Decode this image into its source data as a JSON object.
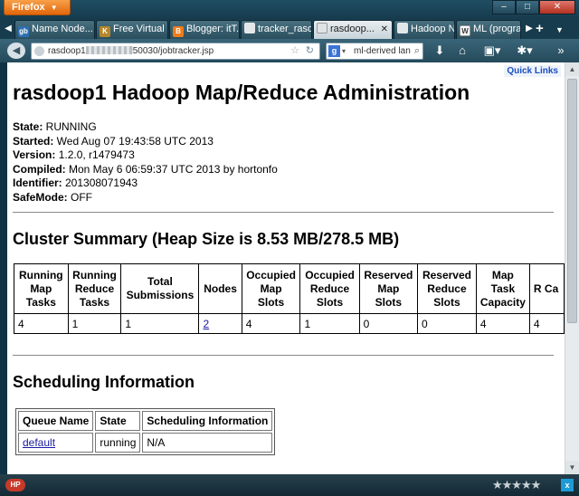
{
  "browser": {
    "menu_button": "Firefox",
    "window_buttons": {
      "minimize": "–",
      "maximize": "□",
      "close": "✕"
    },
    "tabs": [
      {
        "label": "Name Node...",
        "favicon": "gb",
        "favicon_color": "#2d6fb0",
        "active": false
      },
      {
        "label": "Free Virtual ...",
        "favicon": "K",
        "favicon_color": "#b5862a",
        "active": false
      },
      {
        "label": "Blogger: itT...",
        "favicon": "B",
        "favicon_color": "#f07b1a",
        "active": false
      },
      {
        "label": "tracker_rasd...",
        "favicon": "",
        "favicon_color": "#e4e7ea",
        "active": false
      },
      {
        "label": "rasdoop...",
        "favicon": "",
        "favicon_color": "#dfe3e6",
        "active": true
      },
      {
        "label": "Hadoop Na...",
        "favicon": "",
        "favicon_color": "#e4e7ea",
        "active": false
      },
      {
        "label": "ML (progra...",
        "favicon": "W",
        "favicon_color": "#6b6b6b",
        "active": false
      }
    ],
    "url_prefix": "rasdoop1",
    "url_suffix": "50030/jobtracker.jsp",
    "search_value": "ml-derived lan",
    "search_engine_icon": "g-icon"
  },
  "page": {
    "quick_links": "Quick Links",
    "title": "rasdoop1 Hadoop Map/Reduce Administration",
    "info": [
      {
        "label": "State:",
        "value": " RUNNING"
      },
      {
        "label": "Started:",
        "value": " Wed Aug 07 19:43:58 UTC 2013"
      },
      {
        "label": "Version:",
        "value": " 1.2.0, r1479473"
      },
      {
        "label": "Compiled:",
        "value": " Mon May 6 06:59:37 UTC 2013 by hortonfo"
      },
      {
        "label": "Identifier:",
        "value": " 201308071943"
      },
      {
        "label": "SafeMode:",
        "value": " OFF"
      }
    ],
    "cluster_summary": {
      "heading": "Cluster Summary (Heap Size is 8.53 MB/278.5 MB)",
      "headers": [
        "Running Map Tasks",
        "Running Reduce Tasks",
        "Total Submissions",
        "Nodes",
        "Occupied Map Slots",
        "Occupied Reduce Slots",
        "Reserved Map Slots",
        "Reserved Reduce Slots",
        "Map Task Capacity",
        "R Ca"
      ],
      "row": [
        "4",
        "1",
        "1",
        "2",
        "4",
        "1",
        "0",
        "0",
        "4",
        "4"
      ]
    },
    "scheduling": {
      "heading": "Scheduling Information",
      "headers": [
        "Queue Name",
        "State",
        "Scheduling Information"
      ],
      "row": [
        "default",
        "running",
        "N/A"
      ]
    }
  }
}
